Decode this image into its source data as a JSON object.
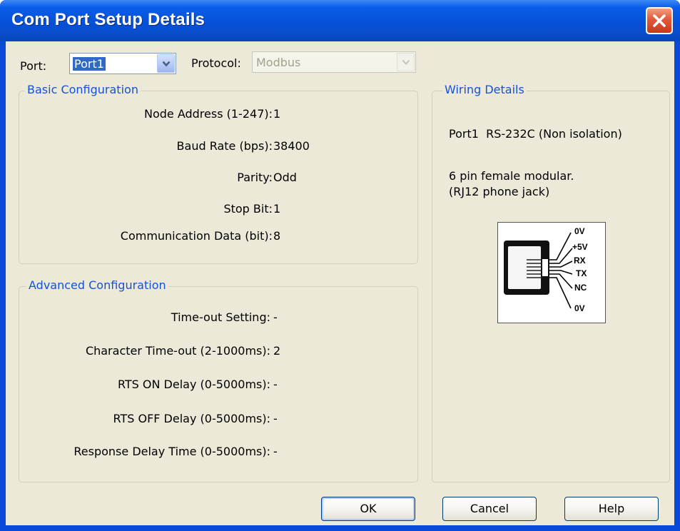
{
  "window": {
    "title": "Com Port Setup Details"
  },
  "port": {
    "label": "Port:",
    "value": "Port1"
  },
  "protocol": {
    "label": "Protocol:",
    "value": "Modbus"
  },
  "basic": {
    "legend": "Basic Configuration",
    "rows": [
      {
        "label": "Node Address (1-247):",
        "value": "1"
      },
      {
        "label": "Baud Rate (bps):",
        "value": "38400"
      },
      {
        "label": "Parity:",
        "value": "Odd"
      },
      {
        "label": "Stop Bit:",
        "value": "1"
      },
      {
        "label": "Communication Data (bit):",
        "value": "8"
      }
    ]
  },
  "advanced": {
    "legend": "Advanced Configuration",
    "rows": [
      {
        "label": "Time-out Setting:",
        "value": "-"
      },
      {
        "label": "Character Time-out (2-1000ms):",
        "value": "2"
      },
      {
        "label": "RTS ON Delay (0-5000ms):",
        "value": "-"
      },
      {
        "label": "RTS OFF Delay (0-5000ms):",
        "value": "-"
      },
      {
        "label": "Response Delay Time (0-5000ms):",
        "value": "-"
      }
    ]
  },
  "wiring": {
    "legend": "Wiring Details",
    "line1": "Port1  RS-232C (Non isolation)",
    "line2": "6 pin female modular.",
    "line3": "(RJ12 phone jack)",
    "pins": [
      "0V",
      "+5V",
      "RX",
      "TX",
      "NC",
      "0V"
    ]
  },
  "buttons": {
    "ok": "OK",
    "cancel": "Cancel",
    "help": "Help"
  },
  "icons": {
    "close": "close-icon",
    "dropdown": "chevron-down-icon",
    "jack": "rj12-jack-icon"
  },
  "colors": {
    "title_bar": "#0651d8",
    "close_button": "#e2583a",
    "group_legend": "#1452d6",
    "dialog_bg": "#ece9d8"
  }
}
